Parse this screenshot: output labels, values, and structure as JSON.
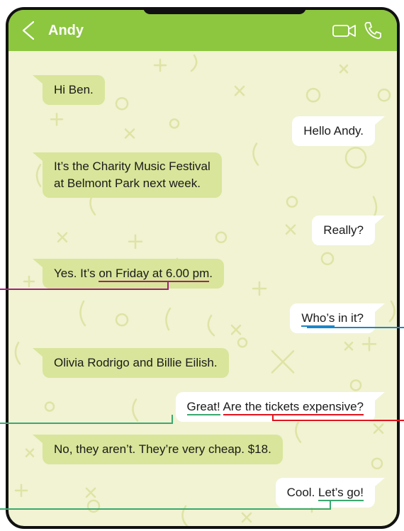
{
  "header": {
    "contact_name": "Andy",
    "back_icon": "chevron-left-icon",
    "video_icon": "video-camera-icon",
    "phone_icon": "phone-icon"
  },
  "colors": {
    "header": "#8dc63f",
    "chat_background": "#f1f3d3",
    "incoming_bubble": "#d9e59a",
    "outgoing_bubble": "#ffffff",
    "highlight_purple": "#a0207a",
    "highlight_blue": "#1d86c7",
    "highlight_green": "#3aa96f",
    "highlight_red": "#e0141c"
  },
  "messages": {
    "m1": "Hi Ben.",
    "m2": "Hello Andy.",
    "m3_line1": "It’s the Charity Music Festival",
    "m3_line2": "at Belmont Park next week.",
    "m4": "Really?",
    "m5_pre": "Yes. It’s ",
    "m5_highlight": "on Friday at 6.00 pm",
    "m5_post": ".",
    "m6_highlight": "Who’s",
    "m6_post": " in it?",
    "m7": "Olivia Rodrigo and Billie Eilish.",
    "m8_highlight1": "Great!",
    "m8_space": " ",
    "m8_highlight2": "Are the tickets expensive?",
    "m9": "No, they aren’t. They’re very cheap. $18.",
    "m10_pre": "Cool. ",
    "m10_highlight": "Let’s go!"
  }
}
